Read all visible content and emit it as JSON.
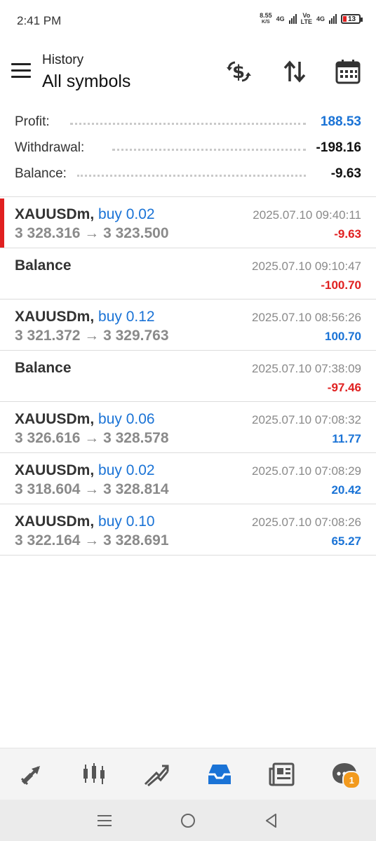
{
  "status_bar": {
    "time": "2:41 PM",
    "speed_value": "8.55",
    "speed_unit": "K/S",
    "net1": "4G",
    "volte_top": "Vo",
    "volte_bottom": "LTE",
    "net2": "4G",
    "battery": "13",
    "battery_color": "#e02020"
  },
  "header": {
    "subtitle": "History",
    "title": "All symbols",
    "icons": [
      "menu-icon",
      "dollar-exchange-icon",
      "sort-icon",
      "calendar-icon"
    ]
  },
  "summary": {
    "profit": {
      "label": "Profit:",
      "value": "188.53"
    },
    "withdrawal": {
      "label": "Withdrawal:",
      "value": "-198.16"
    },
    "balance": {
      "label": "Balance:",
      "value": "-9.63"
    }
  },
  "colors": {
    "accent_blue": "#1a73d6",
    "loss_red": "#e02020",
    "gray_text": "#8a8a8a"
  },
  "history": [
    {
      "type": "trade",
      "symbol": "XAUUSDm,",
      "side": "buy 0.02",
      "prices": "3 328.316 → 3 323.500",
      "date": "2025.07.10 09:40:11",
      "pl": "-9.63",
      "pl_color": "red",
      "selected": true
    },
    {
      "type": "balance",
      "symbol": "Balance",
      "date": "2025.07.10 09:10:47",
      "pl": "-100.70",
      "pl_color": "red"
    },
    {
      "type": "trade",
      "symbol": "XAUUSDm,",
      "side": "buy 0.12",
      "prices": "3 321.372 → 3 329.763",
      "date": "2025.07.10 08:56:26",
      "pl": "100.70",
      "pl_color": "blue"
    },
    {
      "type": "balance",
      "symbol": "Balance",
      "date": "2025.07.10 07:38:09",
      "pl": "-97.46",
      "pl_color": "red"
    },
    {
      "type": "trade",
      "symbol": "XAUUSDm,",
      "side": "buy 0.06",
      "prices": "3 326.616 → 3 328.578",
      "date": "2025.07.10 07:08:32",
      "pl": "11.77",
      "pl_color": "blue"
    },
    {
      "type": "trade",
      "symbol": "XAUUSDm,",
      "side": "buy 0.02",
      "prices": "3 318.604 → 3 328.814",
      "date": "2025.07.10 07:08:29",
      "pl": "20.42",
      "pl_color": "blue"
    },
    {
      "type": "trade",
      "symbol": "XAUUSDm,",
      "side": "buy 0.10",
      "prices": "3 322.164 → 3 328.691",
      "date": "2025.07.10 07:08:26",
      "pl": "65.27",
      "pl_color": "blue"
    }
  ],
  "bottom_nav": {
    "tabs": [
      "quotes-icon",
      "chart-icon",
      "trade-icon",
      "history-icon",
      "news-icon",
      "messages-icon"
    ],
    "active": "history-icon",
    "messages_badge": "1"
  },
  "system_nav": [
    "recents-icon",
    "home-icon",
    "back-icon"
  ]
}
